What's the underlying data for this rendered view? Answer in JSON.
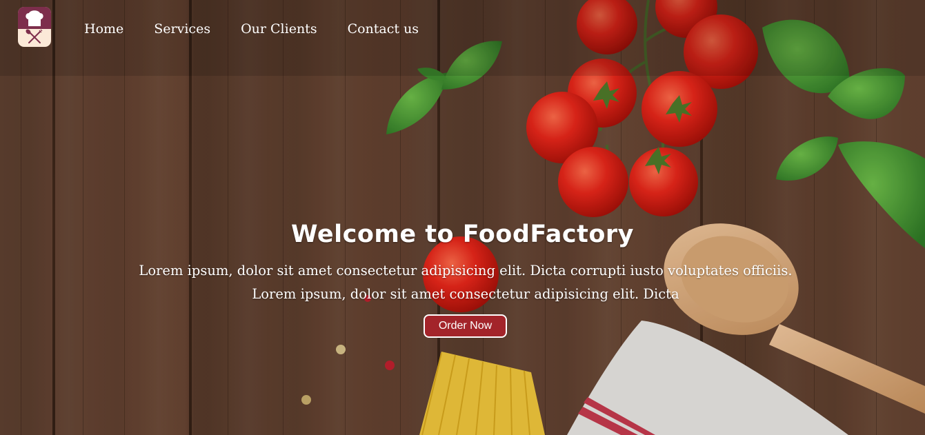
{
  "brand": {
    "logo_icon": "chef-hat-utensils-icon",
    "logo_color": "#7d2e4c"
  },
  "nav": {
    "items": [
      {
        "label": "Home"
      },
      {
        "label": "Services"
      },
      {
        "label": "Our Clients"
      },
      {
        "label": "Contact us"
      }
    ]
  },
  "hero": {
    "title": "Welcome to FoodFactory",
    "text_line1": "Lorem ipsum, dolor sit amet consectetur adipisicing elit. Dicta corrupti iusto voluptates officiis.",
    "text_line2": "Lorem ipsum, dolor sit amet consectetur adipisicing elit. Dicta",
    "cta_label": "Order Now",
    "cta_color": "#a3242a",
    "background": "wooden-table-with-tomatoes-basil-spoon-pasta"
  }
}
